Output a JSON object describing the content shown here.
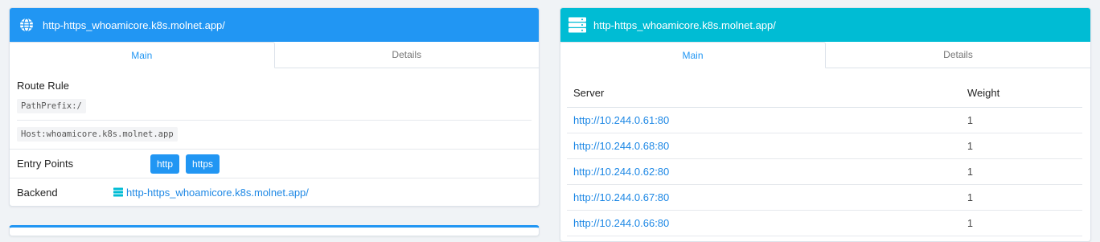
{
  "frontend": {
    "title": "http-https_whoamicore.k8s.molnet.app/",
    "icon": "globe-icon",
    "tabs": [
      {
        "label": "Main",
        "active": true
      },
      {
        "label": "Details",
        "active": false
      }
    ],
    "route_rule": {
      "label": "Route Rule",
      "rules": [
        "PathPrefix:/",
        "Host:whoamicore.k8s.molnet.app"
      ]
    },
    "entry_points": {
      "label": "Entry Points",
      "values": [
        "http",
        "https"
      ]
    },
    "backend": {
      "label": "Backend",
      "icon": "server-icon",
      "link": "http-https_whoamicore.k8s.molnet.app/"
    },
    "colors": {
      "header": "#2196f3",
      "badge": "#2196f3"
    }
  },
  "backend_panel": {
    "title": "http-https_whoamicore.k8s.molnet.app/",
    "icon": "server-icon",
    "tabs": [
      {
        "label": "Main",
        "active": true
      },
      {
        "label": "Details",
        "active": false
      }
    ],
    "columns": [
      "Server",
      "Weight"
    ],
    "servers": [
      {
        "url": "http://10.244.0.61:80",
        "weight": "1"
      },
      {
        "url": "http://10.244.0.68:80",
        "weight": "1"
      },
      {
        "url": "http://10.244.0.62:80",
        "weight": "1"
      },
      {
        "url": "http://10.244.0.67:80",
        "weight": "1"
      },
      {
        "url": "http://10.244.0.66:80",
        "weight": "1"
      }
    ],
    "colors": {
      "header": "#00bcd4",
      "link": "#1e88e5"
    }
  }
}
